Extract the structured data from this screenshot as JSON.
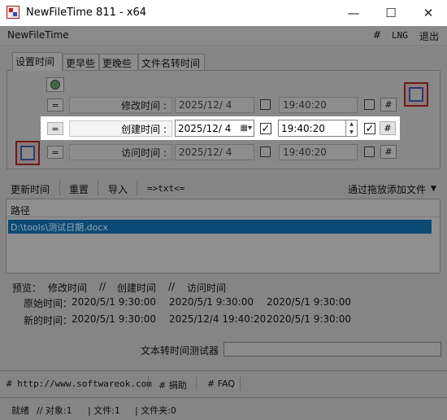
{
  "window": {
    "title": "NewFileTime 811 - x64",
    "controls": {
      "minimize": "—",
      "maximize": "☐",
      "close": "✕"
    }
  },
  "menubar": {
    "app_name": "NewFileTime",
    "hash": "#",
    "lng": "LNG",
    "exit": "退出"
  },
  "tabs": [
    "设置时间",
    "更早些",
    "更晚些",
    "文件名转时间"
  ],
  "rows": [
    {
      "eq": "=",
      "label": "修改时间 :",
      "date": "2025/12/  4",
      "time": "19:40:20",
      "hash": "#",
      "date_checked": false,
      "time_checked": false
    },
    {
      "eq": "=",
      "label": "创建时间 :",
      "date": "2025/12/  4",
      "time": "19:40:20",
      "hash": "#",
      "date_checked": true,
      "time_checked": true
    },
    {
      "eq": "=",
      "label": "访问时间 :",
      "date": "2025/12/  4",
      "time": "19:40:20",
      "hash": "#",
      "date_checked": false,
      "time_checked": false
    }
  ],
  "toolbar": {
    "update": "更新时间",
    "reset": "重置",
    "import": "导入",
    "txt": "=>txt<=",
    "add_drag": "通过拖放添加文件",
    "dropdown_icon": "▼"
  },
  "list": {
    "header": "路径",
    "items": [
      "D:\\tools\\测试日期.docx"
    ]
  },
  "preview": {
    "title": "预览：",
    "col_modify": "修改时间",
    "sep": "//",
    "col_create": "创建时间",
    "col_access": "访问时间",
    "original_label": "原始时间：",
    "new_label": "新的时间：",
    "original": [
      "2020/5/1 9:30:00",
      "2020/5/1 9:30:00",
      "2020/5/1 9:30:00"
    ],
    "new": [
      "2020/5/1 9:30:00",
      "2025/12/4 19:40:20",
      "2020/5/1 9:30:00"
    ]
  },
  "tester": {
    "label": "文本转时间测试器",
    "value": ""
  },
  "footer_links": {
    "site": "# http://www.softwareok.com",
    "donate": "# 捐助",
    "faq": "# FAQ"
  },
  "status": {
    "ready": "就绪",
    "objects": "// 对象:1",
    "files": "| 文件:1",
    "folders": "| 文件夹:0"
  }
}
